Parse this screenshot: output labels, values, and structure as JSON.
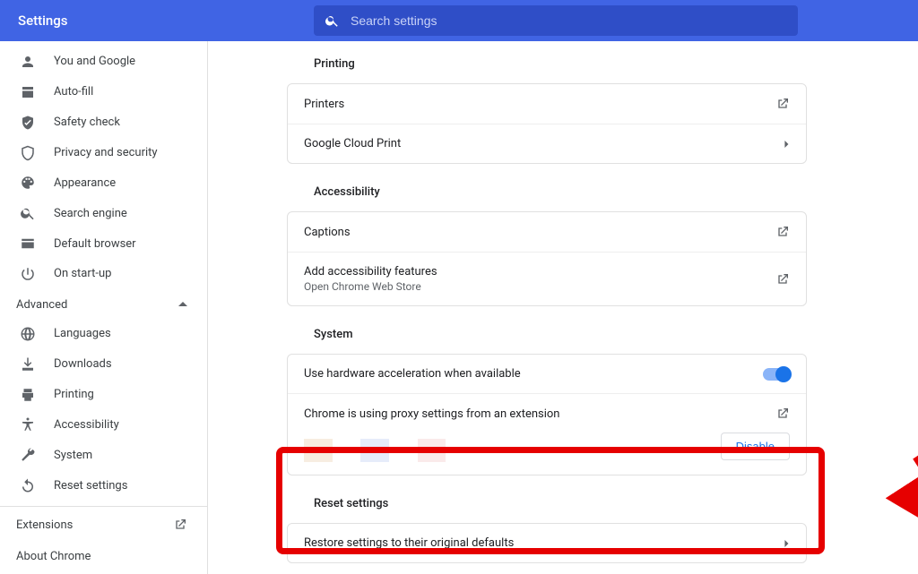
{
  "header": {
    "title": "Settings",
    "search_placeholder": "Search settings"
  },
  "sidebar": {
    "items_basic": [
      {
        "label": "You and Google",
        "icon": "person"
      },
      {
        "label": "Auto-fill",
        "icon": "autofill"
      },
      {
        "label": "Safety check",
        "icon": "safety"
      },
      {
        "label": "Privacy and security",
        "icon": "shield"
      },
      {
        "label": "Appearance",
        "icon": "palette"
      },
      {
        "label": "Search engine",
        "icon": "search"
      },
      {
        "label": "Default browser",
        "icon": "browser"
      },
      {
        "label": "On start-up",
        "icon": "power"
      }
    ],
    "advanced_label": "Advanced",
    "items_advanced": [
      {
        "label": "Languages",
        "icon": "globe"
      },
      {
        "label": "Downloads",
        "icon": "download"
      },
      {
        "label": "Printing",
        "icon": "print"
      },
      {
        "label": "Accessibility",
        "icon": "a11y"
      },
      {
        "label": "System",
        "icon": "wrench"
      },
      {
        "label": "Reset settings",
        "icon": "reset"
      }
    ],
    "extensions": "Extensions",
    "about": "About Chrome"
  },
  "sections": {
    "printing": {
      "title": "Printing",
      "rows": [
        {
          "label": "Printers",
          "trailing": "open"
        },
        {
          "label": "Google Cloud Print",
          "trailing": "chev"
        }
      ]
    },
    "accessibility": {
      "title": "Accessibility",
      "rows": [
        {
          "label": "Captions",
          "trailing": "open"
        },
        {
          "label": "Add accessibility features",
          "sub": "Open Chrome Web Store",
          "trailing": "open"
        }
      ]
    },
    "system": {
      "title": "System",
      "hw_label": "Use hardware acceleration when available",
      "proxy_label": "Chrome is using proxy settings from an extension",
      "disable_label": "Disable"
    },
    "reset": {
      "title": "Reset settings",
      "row_label": "Restore settings to their original defaults"
    }
  }
}
